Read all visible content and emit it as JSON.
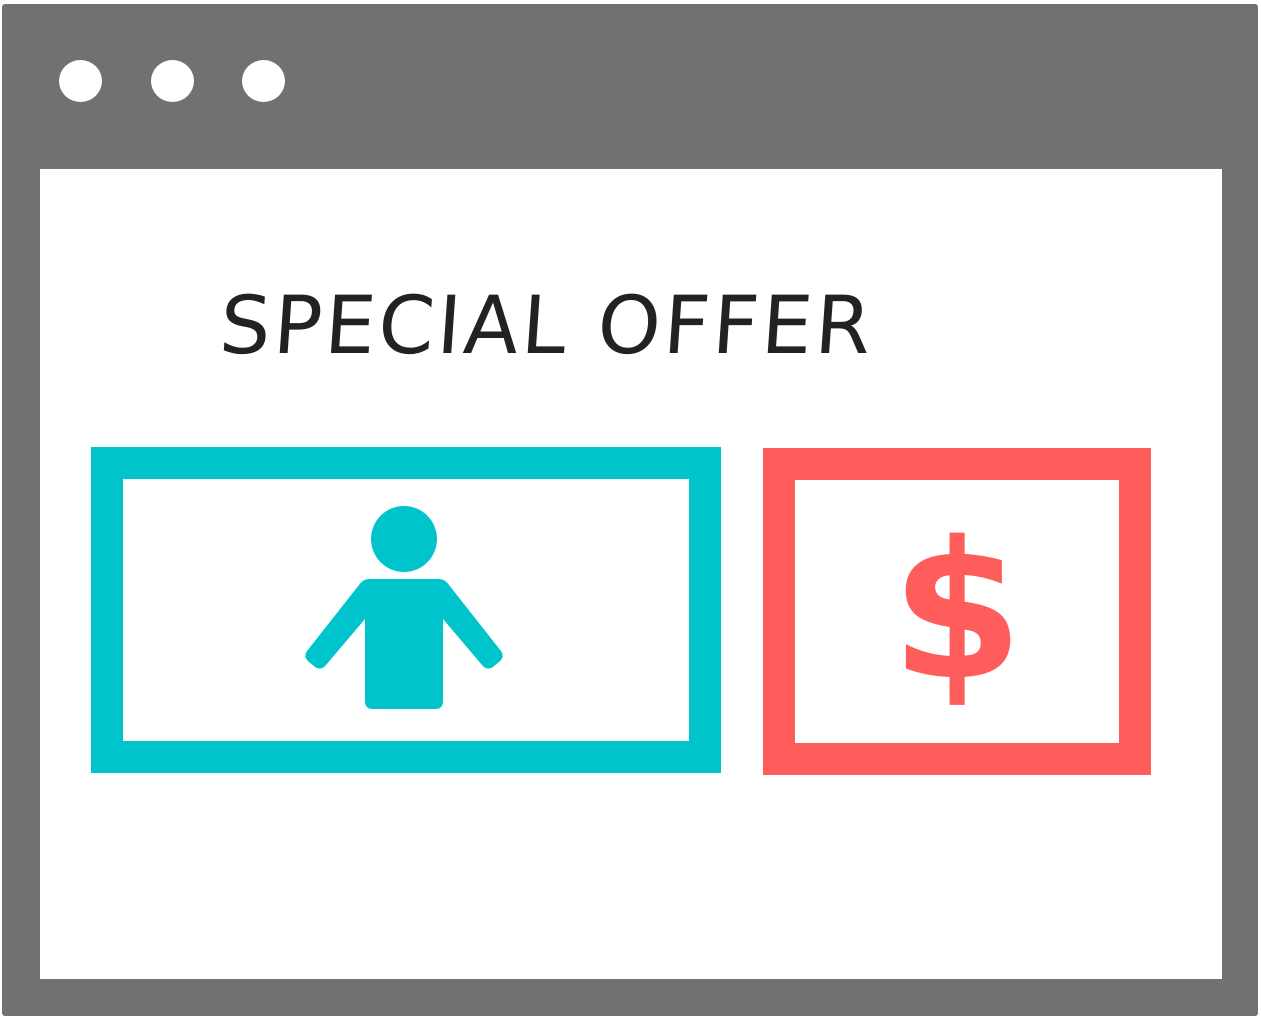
{
  "window": {
    "controls": [
      "window-dot",
      "window-dot",
      "window-dot"
    ]
  },
  "offer": {
    "title": "SPECIAL OFFER",
    "price_symbol": "$",
    "person_icon": "person-icon",
    "colors": {
      "person_accent": "#00c4cc",
      "price_accent": "#ff5c5c",
      "frame": "#717171",
      "text": "#222222"
    }
  }
}
